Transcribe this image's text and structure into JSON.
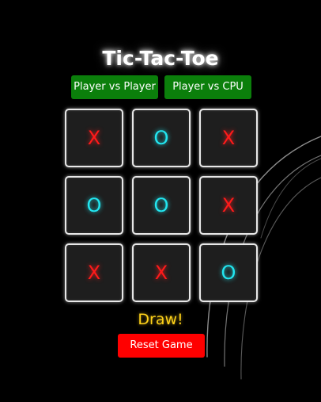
{
  "game": {
    "title": "Tic-Tac-Toe",
    "status": "Draw!"
  },
  "modes": {
    "pvp_label": "Player vs Player",
    "cpu_label": "Player vs CPU"
  },
  "board": {
    "cells": [
      "X",
      "O",
      "X",
      "O",
      "O",
      "X",
      "X",
      "X",
      "O"
    ]
  },
  "controls": {
    "reset_label": "Reset Game"
  },
  "colors": {
    "background": "#000000",
    "mode_button": "#0b7f0b",
    "reset_button": "#ff0000",
    "x_mark": "#ff1a1a",
    "o_mark": "#22e6f0",
    "status_text": "#ffd21a",
    "cell_background": "#1e1e1e"
  }
}
